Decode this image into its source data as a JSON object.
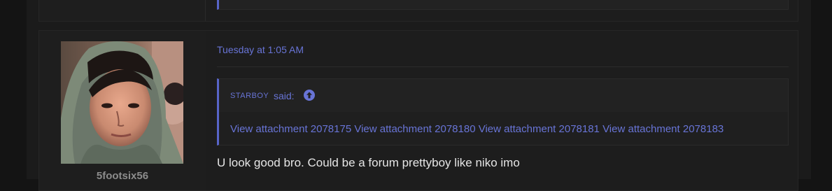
{
  "colors": {
    "accent": "#6874d6",
    "quote_border": "#5865c9",
    "background": "#141414",
    "panel": "#1d1d1d",
    "text": "#e6e6e6",
    "username": "#8c8c8c"
  },
  "post": {
    "username": "5footsix56",
    "date": "Tuesday at 1:05 AM",
    "quote": {
      "author": "STARBOY",
      "said_label": "said:",
      "jump_icon": "arrow-up-circle-icon",
      "attachments": [
        "View attachment 2078175",
        "View attachment 2078180",
        "View attachment 2078181",
        "View attachment 2078183"
      ]
    },
    "body": "U look good bro. Could be a forum prettyboy like niko imo"
  }
}
